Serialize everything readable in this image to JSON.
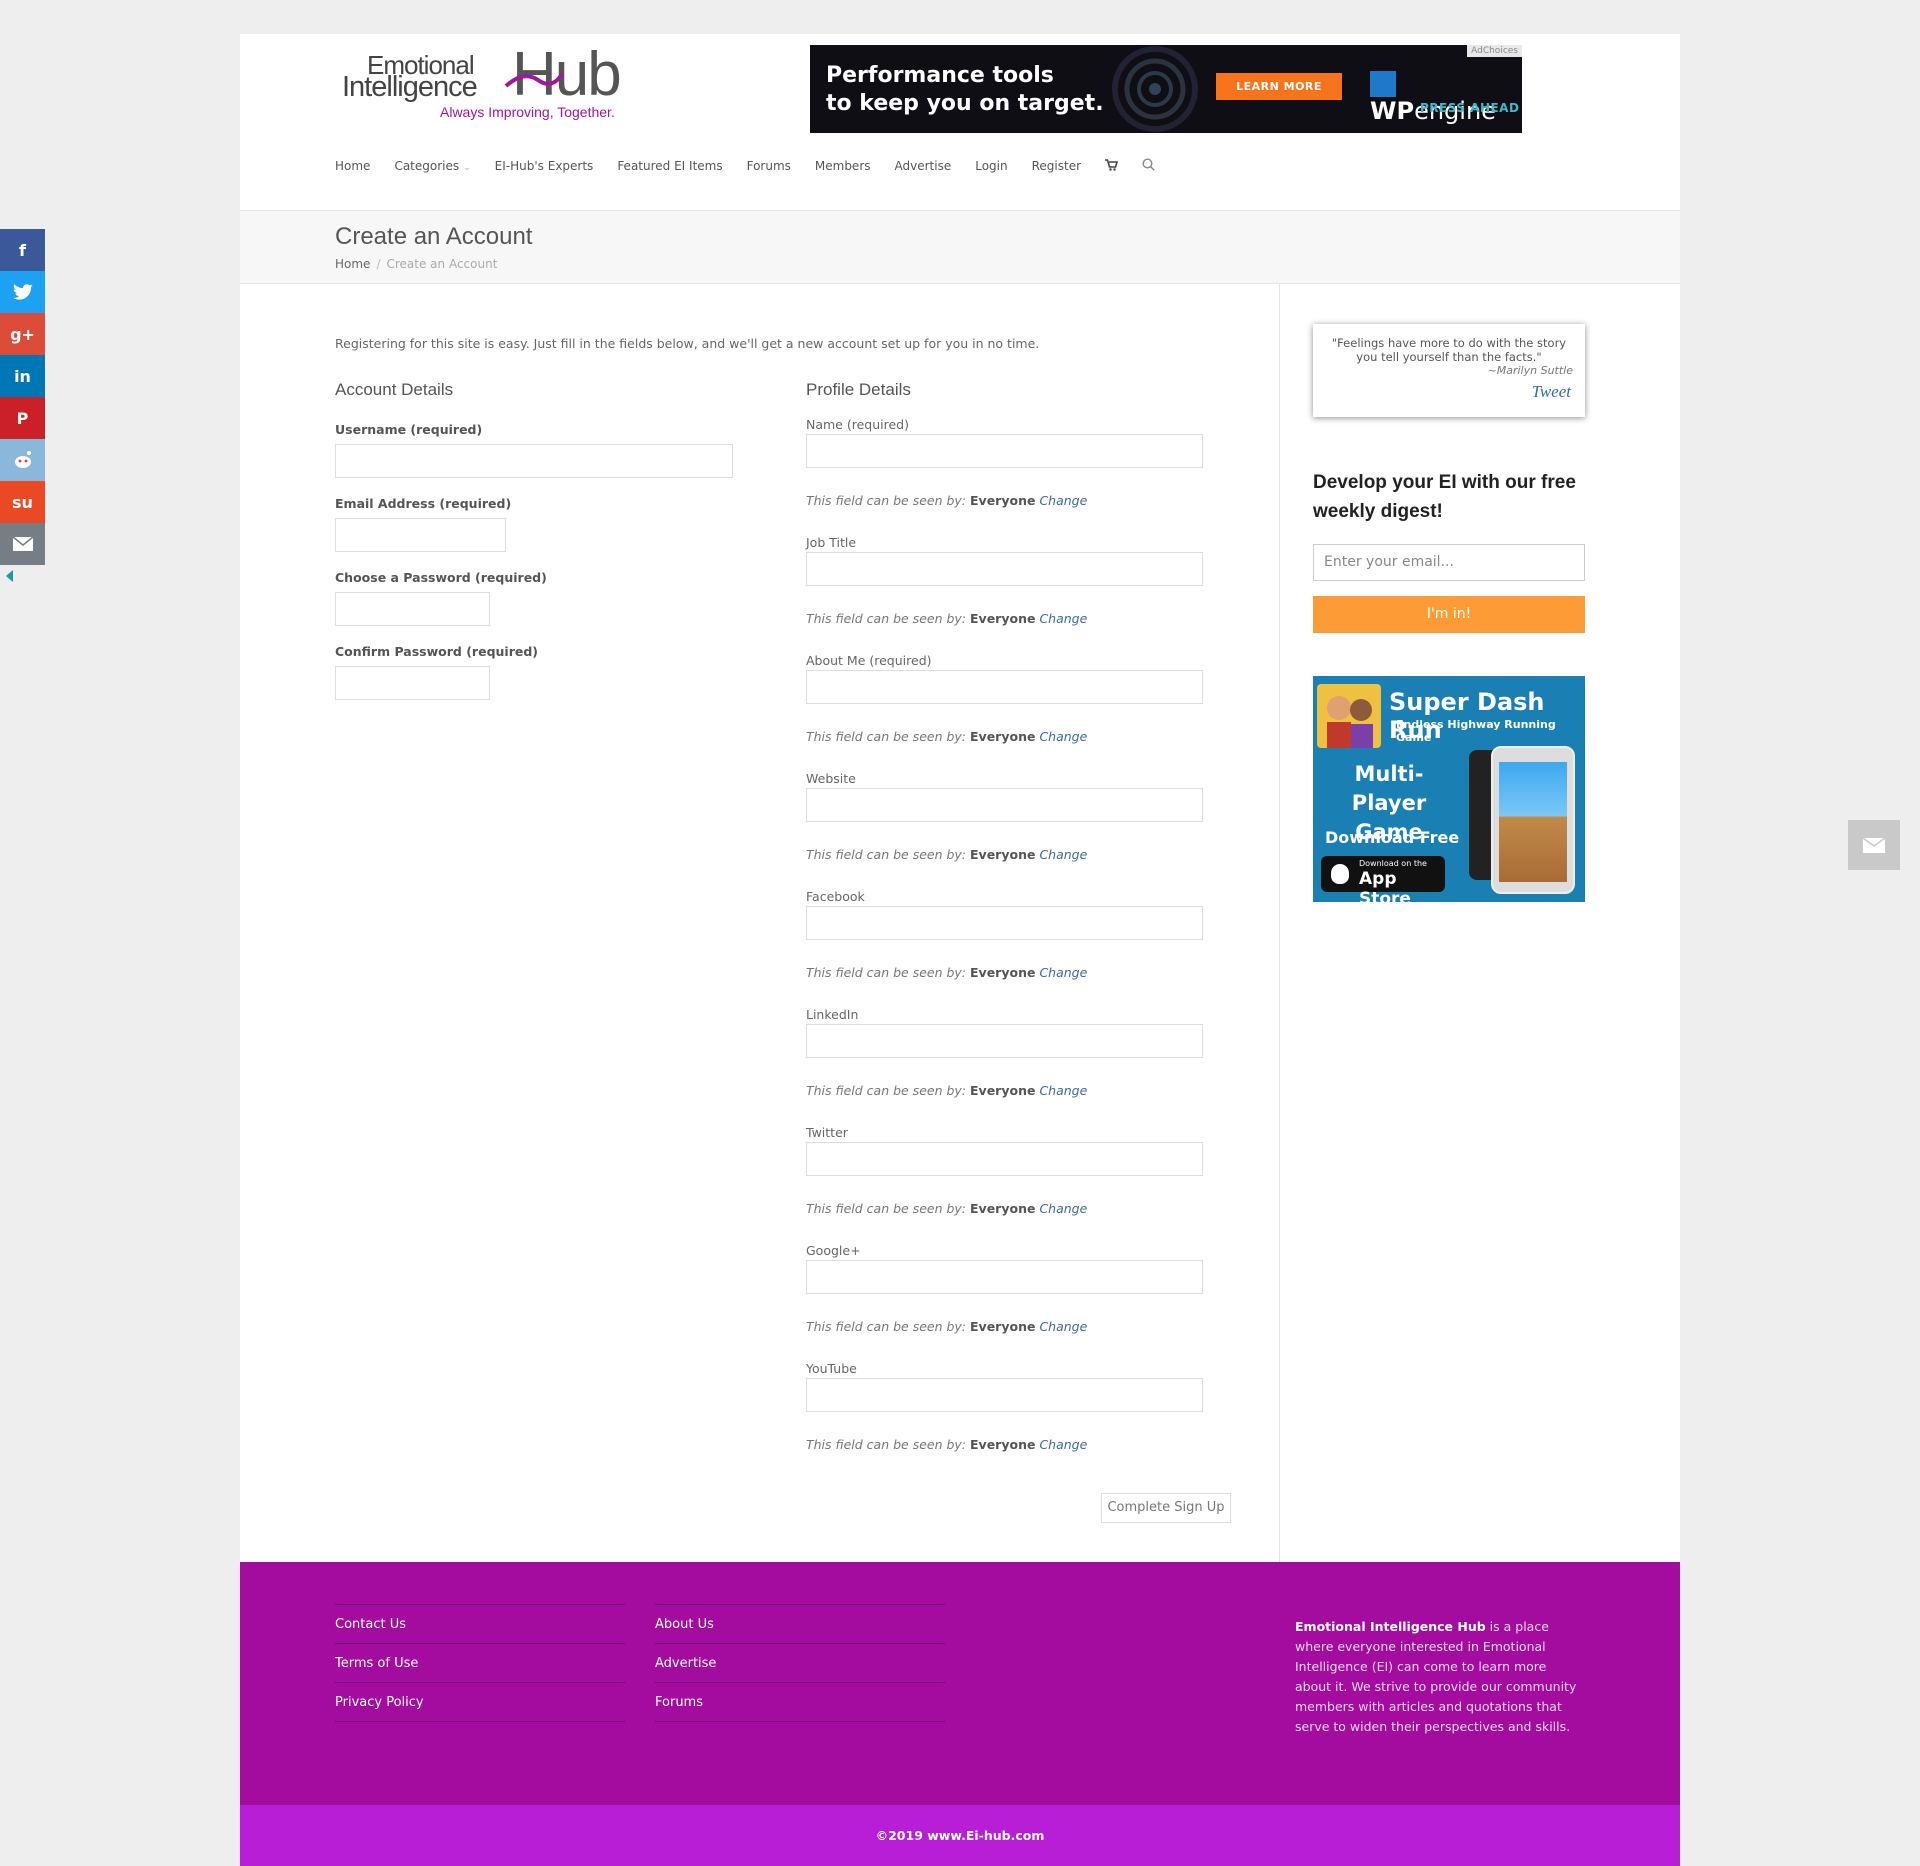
{
  "logo": {
    "line1": "Emotional",
    "line2": "Intelligence",
    "hub": "Hub",
    "tagline": "Always Improving, Together."
  },
  "ad": {
    "headline1": "Performance tools",
    "headline2": "to keep you on target.",
    "cta": "LEARN MORE",
    "brand_bold": "WP",
    "brand_rest": "engine",
    "brand_sub": "PRESS AHEAD",
    "choices": "AdChoices"
  },
  "nav": {
    "items": [
      "Home",
      "Categories",
      "EI-Hub's Experts",
      "Featured EI Items",
      "Forums",
      "Members",
      "Advertise",
      "Login",
      "Register"
    ],
    "cart_icon": "cart-icon",
    "search_icon": "search-icon"
  },
  "page": {
    "title": "Create an Account",
    "breadcrumb_home": "Home",
    "breadcrumb_sep": "/",
    "breadcrumb_current": "Create an Account",
    "intro": "Registering for this site is easy. Just fill in the fields below, and we'll get a new account set up for you in no time."
  },
  "account": {
    "title": "Account Details",
    "username_label": "Username (required)",
    "email_label": "Email Address (required)",
    "password_label": "Choose a Password (required)",
    "confirm_label": "Confirm Password (required)"
  },
  "profile": {
    "title": "Profile Details",
    "visibility_prefix": "This field can be seen by:",
    "visibility_value": "Everyone",
    "visibility_change": "Change",
    "fields": [
      {
        "label": "Name (required)"
      },
      {
        "label": "Job Title"
      },
      {
        "label": "About Me (required)"
      },
      {
        "label": "Website"
      },
      {
        "label": "Facebook"
      },
      {
        "label": "LinkedIn"
      },
      {
        "label": "Twitter"
      },
      {
        "label": "Google+"
      },
      {
        "label": "YouTube"
      }
    ]
  },
  "signup_button": "Complete Sign Up",
  "sidebar": {
    "quote": "\"Feelings have more to do with the story you tell yourself than the facts.\"",
    "quote_author": "~Marilyn Suttle",
    "tweet": "Tweet",
    "digest_heading": "Develop your EI with our free weekly digest!",
    "email_placeholder": "Enter your email...",
    "subscribe_label": "I'm in!",
    "game_ad": {
      "title": "Super Dash Run",
      "subtitle": "Endless Highway Running Game",
      "multiplayer": "Multi-Player Game",
      "download": "Download Free",
      "store_small": "Download on the",
      "store_big": "App Store"
    }
  },
  "footer": {
    "col1": [
      "Contact Us",
      "Terms of Use",
      "Privacy Policy"
    ],
    "col2": [
      "About Us",
      "Advertise",
      "Forums"
    ],
    "about_bold": "Emotional Intelligence Hub",
    "about_rest": " is a place where everyone interested in Emotional Intelligence (EI) can come to learn more about it. We strive to provide our community members with articles and quotations that serve to widen their perspectives and skills.",
    "copyright": "©2019 www.Ei-hub.com"
  },
  "social": [
    {
      "icon": "facebook-icon",
      "glyph": "f",
      "color": "#3b5998"
    },
    {
      "icon": "twitter-icon",
      "glyph": "t",
      "color": "#1da1f2"
    },
    {
      "icon": "google-plus-icon",
      "glyph": "g+",
      "color": "#dd4b39"
    },
    {
      "icon": "linkedin-icon",
      "glyph": "in",
      "color": "#0077b5"
    },
    {
      "icon": "pinterest-icon",
      "glyph": "P",
      "color": "#cb2027"
    },
    {
      "icon": "reddit-icon",
      "glyph": "r",
      "color": "#8ab8dc"
    },
    {
      "icon": "stumbleupon-icon",
      "glyph": "su",
      "color": "#eb4924"
    },
    {
      "icon": "email-icon",
      "glyph": "✉",
      "color": "#757e85"
    }
  ],
  "colors": {
    "footer": "#a30c9f",
    "copyright_bar": "#b81ed6",
    "subscribe_button": "#fd9c37",
    "link": "#3b6aa8"
  }
}
